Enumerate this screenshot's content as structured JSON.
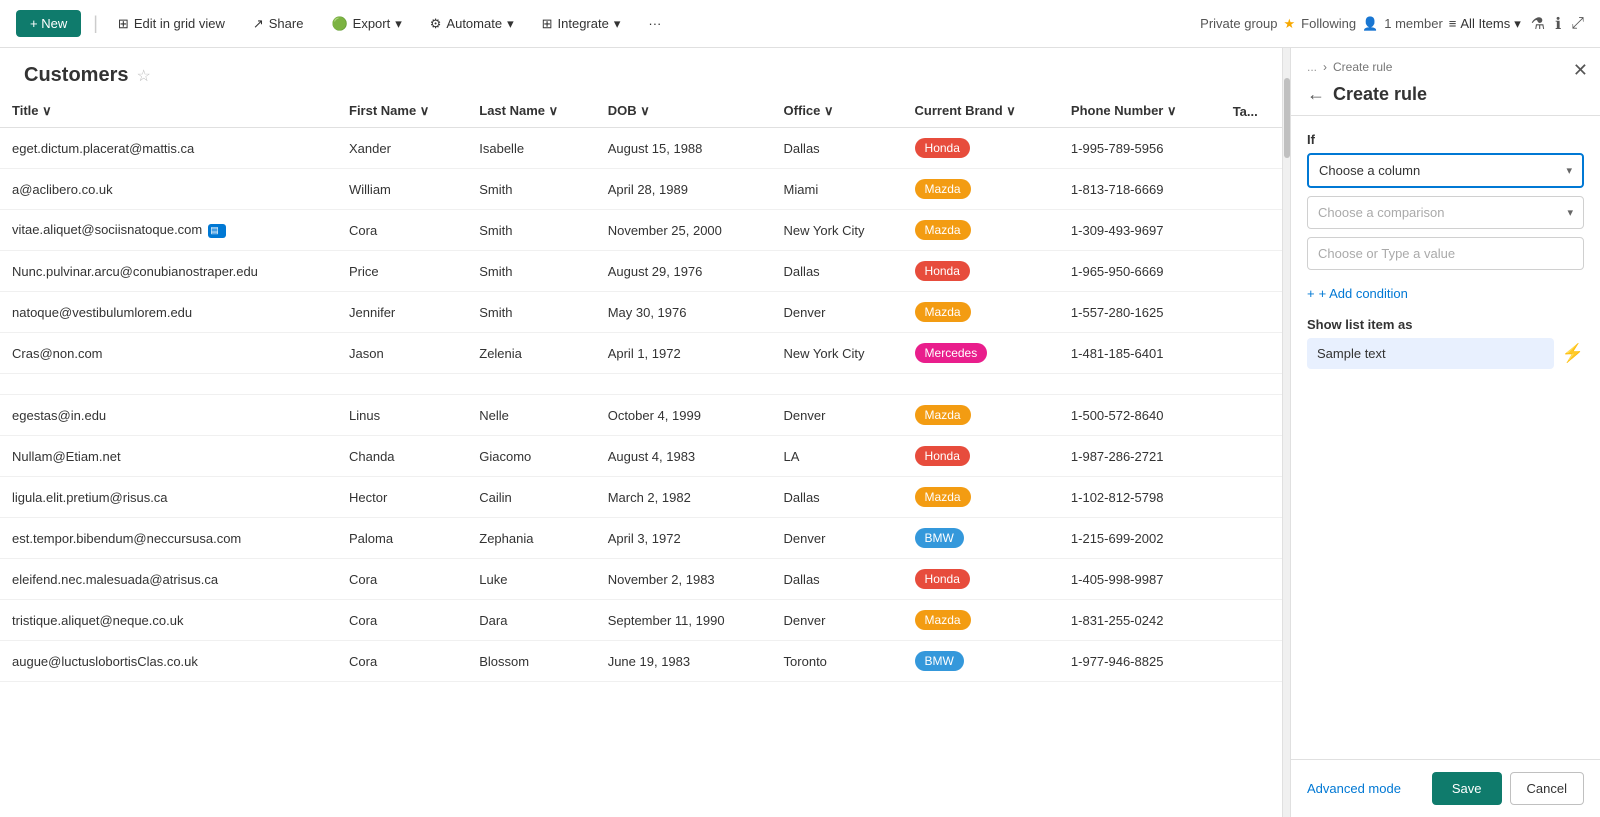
{
  "topbar": {
    "private_group": "Private group",
    "following": "Following",
    "member_count": "1 member",
    "new_btn": "+ New",
    "edit_grid": "Edit in grid view",
    "share": "Share",
    "export": "Export",
    "automate": "Automate",
    "integrate": "Integrate",
    "all_items": "All Items"
  },
  "page": {
    "title": "Customers"
  },
  "table": {
    "columns": [
      "Title",
      "First Name",
      "Last Name",
      "DOB",
      "Office",
      "Current Brand",
      "Phone Number",
      "Ta..."
    ],
    "rows": [
      {
        "title": "eget.dictum.placerat@mattis.ca",
        "first": "Xander",
        "last": "Isabelle",
        "dob": "August 15, 1988",
        "office": "Dallas",
        "brand": "Honda",
        "brand_class": "brand-honda",
        "phone": "1-995-789-5956"
      },
      {
        "title": "a@aclibero.co.uk",
        "first": "William",
        "last": "Smith",
        "dob": "April 28, 1989",
        "office": "Miami",
        "brand": "Mazda",
        "brand_class": "brand-mazda",
        "phone": "1-813-718-6669"
      },
      {
        "title": "vitae.aliquet@sociisnatoque.com",
        "first": "Cora",
        "last": "Smith",
        "dob": "November 25, 2000",
        "office": "New York City",
        "brand": "Mazda",
        "brand_class": "brand-mazda",
        "phone": "1-309-493-9697",
        "has_chat": true
      },
      {
        "title": "Nunc.pulvinar.arcu@conubianostraper.edu",
        "first": "Price",
        "last": "Smith",
        "dob": "August 29, 1976",
        "office": "Dallas",
        "brand": "Honda",
        "brand_class": "brand-honda",
        "phone": "1-965-950-6669"
      },
      {
        "title": "natoque@vestibulumlorem.edu",
        "first": "Jennifer",
        "last": "Smith",
        "dob": "May 30, 1976",
        "office": "Denver",
        "brand": "Mazda",
        "brand_class": "brand-mazda",
        "phone": "1-557-280-1625"
      },
      {
        "title": "Cras@non.com",
        "first": "Jason",
        "last": "Zelenia",
        "dob": "April 1, 1972",
        "office": "New York City",
        "brand": "Mercedes",
        "brand_class": "brand-mercedes",
        "phone": "1-481-185-6401"
      },
      {
        "title": "",
        "first": "",
        "last": "",
        "dob": "",
        "office": "",
        "brand": "",
        "brand_class": "",
        "phone": ""
      },
      {
        "title": "egestas@in.edu",
        "first": "Linus",
        "last": "Nelle",
        "dob": "October 4, 1999",
        "office": "Denver",
        "brand": "Mazda",
        "brand_class": "brand-mazda",
        "phone": "1-500-572-8640"
      },
      {
        "title": "Nullam@Etiam.net",
        "first": "Chanda",
        "last": "Giacomo",
        "dob": "August 4, 1983",
        "office": "LA",
        "brand": "Honda",
        "brand_class": "brand-honda",
        "phone": "1-987-286-2721"
      },
      {
        "title": "ligula.elit.pretium@risus.ca",
        "first": "Hector",
        "last": "Cailin",
        "dob": "March 2, 1982",
        "office": "Dallas",
        "brand": "Mazda",
        "brand_class": "brand-mazda",
        "phone": "1-102-812-5798"
      },
      {
        "title": "est.tempor.bibendum@neccursusa.com",
        "first": "Paloma",
        "last": "Zephania",
        "dob": "April 3, 1972",
        "office": "Denver",
        "brand": "BMW",
        "brand_class": "brand-bmw",
        "phone": "1-215-699-2002"
      },
      {
        "title": "eleifend.nec.malesuada@atrisus.ca",
        "first": "Cora",
        "last": "Luke",
        "dob": "November 2, 1983",
        "office": "Dallas",
        "brand": "Honda",
        "brand_class": "brand-honda",
        "phone": "1-405-998-9987"
      },
      {
        "title": "tristique.aliquet@neque.co.uk",
        "first": "Cora",
        "last": "Dara",
        "dob": "September 11, 1990",
        "office": "Denver",
        "brand": "Mazda",
        "brand_class": "brand-mazda",
        "phone": "1-831-255-0242"
      },
      {
        "title": "augue@luctuslobortisClas.co.uk",
        "first": "Cora",
        "last": "Blossom",
        "dob": "June 19, 1983",
        "office": "Toronto",
        "brand": "BMW",
        "brand_class": "brand-bmw",
        "phone": "1-977-946-8825"
      }
    ]
  },
  "panel": {
    "breadcrumb_dots": "...",
    "breadcrumb_arrow": "›",
    "breadcrumb_text": "Create rule",
    "back_arrow": "←",
    "title": "Create rule",
    "if_label": "If",
    "choose_column_placeholder": "Choose a column",
    "choose_comparison_placeholder": "Choose a comparison",
    "choose_value_placeholder": "Choose or Type a value",
    "add_condition": "+ Add condition",
    "show_section_label": "Show list item as",
    "sample_text": "Sample text",
    "advanced_mode": "Advanced mode",
    "save_btn": "Save",
    "cancel_btn": "Cancel"
  }
}
